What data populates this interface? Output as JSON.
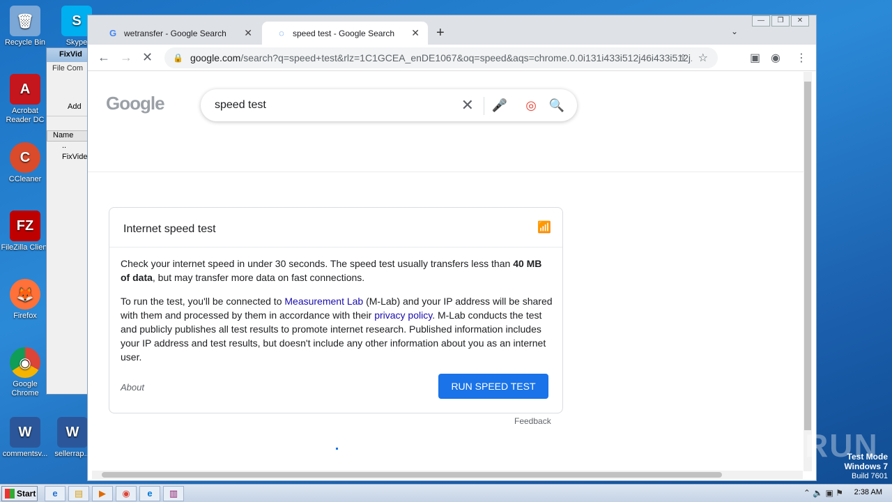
{
  "desktop": {
    "icons": [
      {
        "label": "Recycle Bin",
        "glyph": "🗑"
      },
      {
        "label": "Skype",
        "glyph": "S"
      },
      {
        "label": "Acrobat Reader DC",
        "glyph": "A"
      },
      {
        "label": "CCleaner",
        "glyph": "C"
      },
      {
        "label": "FileZilla Client",
        "glyph": "FZ"
      },
      {
        "label": "Firefox",
        "glyph": "🦊"
      },
      {
        "label": "Google Chrome",
        "glyph": "◉"
      },
      {
        "label": "commentsv...",
        "glyph": "W"
      },
      {
        "label": "sellerrap...",
        "glyph": "W"
      }
    ]
  },
  "fixwin": {
    "title": "FixVid",
    "menu": "File  Com",
    "add_label": "Add",
    "column": "Name",
    "rows": [
      "..",
      "FixVide"
    ]
  },
  "browser": {
    "tabs": [
      {
        "title": "wetransfer - Google Search",
        "favicon": "G"
      },
      {
        "title": "speed test - Google Search",
        "favicon": "◌"
      }
    ],
    "new_tab": "+",
    "tab_search": "⌄",
    "window_controls": [
      "—",
      "❐",
      "✕"
    ],
    "url_host": "google.com",
    "url_path": "/search?q=speed+test&rlz=1C1GCEA_enDE1067&oq=speed&aqs=chrome.0.0i131i433i512j46i433i512j...",
    "nav": {
      "back": "←",
      "forward": "→",
      "reload": "✕"
    }
  },
  "search": {
    "query": "speed test",
    "logo": "Google"
  },
  "speedtest": {
    "title": "Internet speed test",
    "p1_start": "Check your internet speed in under 30 seconds. The speed test usually transfers less than ",
    "p1_bold": "40 MB of data",
    "p1_end": ", but may transfer more data on fast connections.",
    "p2_a": "To run the test, you'll be connected to ",
    "p2_link1": "Measurement Lab",
    "p2_b": " (M-Lab) and your IP address will be shared with them and processed by them in accordance with their ",
    "p2_link2": "privacy policy",
    "p2_c": ". M-Lab conducts the test and publicly publishes all test results to promote internet research. Published information includes your IP address and test results, but doesn't include any other information about you as an internet user.",
    "about": "About",
    "run_button": "RUN SPEED TEST",
    "feedback": "Feedback"
  },
  "watermark": {
    "brand": "ANY RUN",
    "test_mode": "Test Mode",
    "os": "Windows 7",
    "build": "Build 7601"
  },
  "taskbar": {
    "start": "Start",
    "clock": "2:38 AM",
    "colors": {
      "accent": "#1a73e8"
    }
  }
}
